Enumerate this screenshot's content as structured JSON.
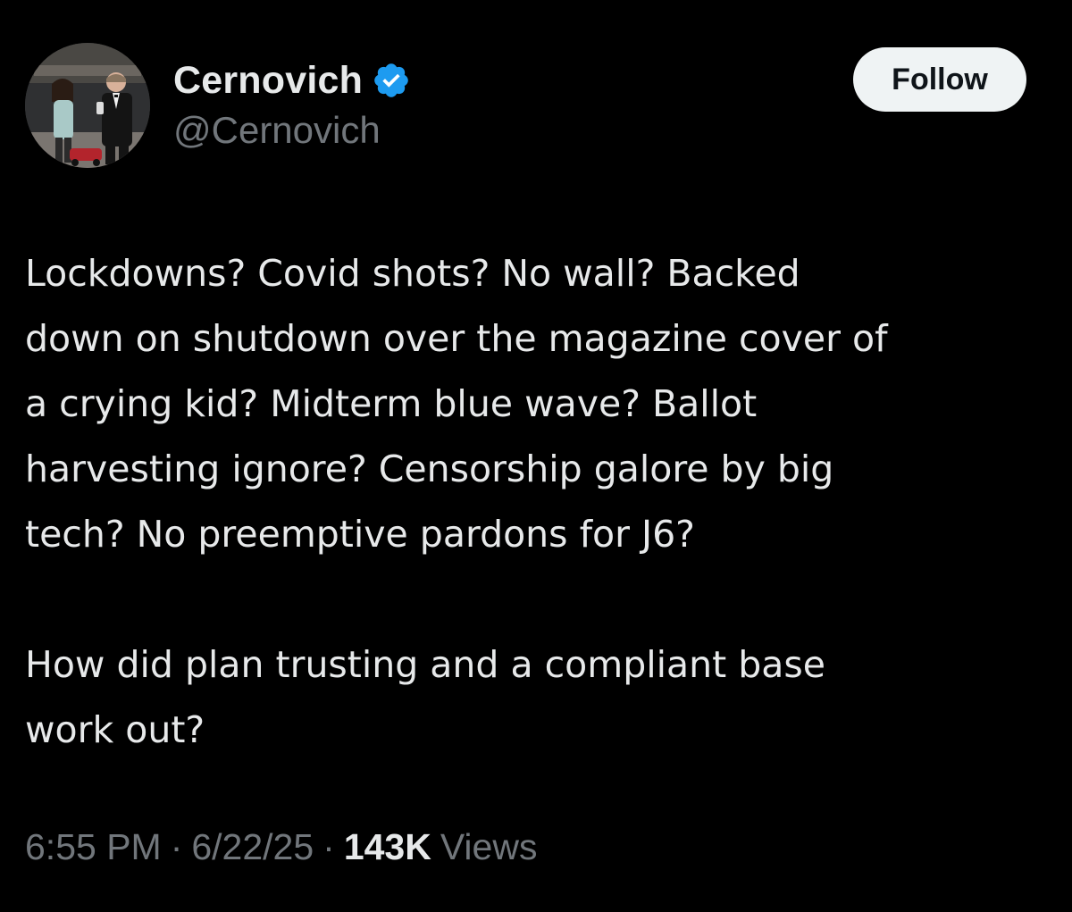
{
  "author": {
    "display_name": "Cernovich",
    "handle": "@Cernovich",
    "verified": true,
    "avatar_icon": "profile-photo"
  },
  "follow_label": "Follow",
  "tweet": {
    "paragraphs": [
      "Lockdowns? Covid shots? No wall? Backed\ndown on shutdown over the magazine cover of\na crying kid? Midterm blue wave? Ballot\nharvesting ignore? Censorship galore by big\ntech? No preemptive pardons for J6?",
      "How did plan trusting and a compliant base\nwork out?"
    ]
  },
  "meta": {
    "time": "6:55 PM",
    "separator": "·",
    "date": "6/22/25",
    "views_count": "143K",
    "views_label": "Views"
  },
  "colors": {
    "background": "#000000",
    "text_primary": "#e7e9ea",
    "text_secondary": "#71767b",
    "verified_badge": "#1d9bf0",
    "follow_button_bg": "#eff3f4"
  }
}
